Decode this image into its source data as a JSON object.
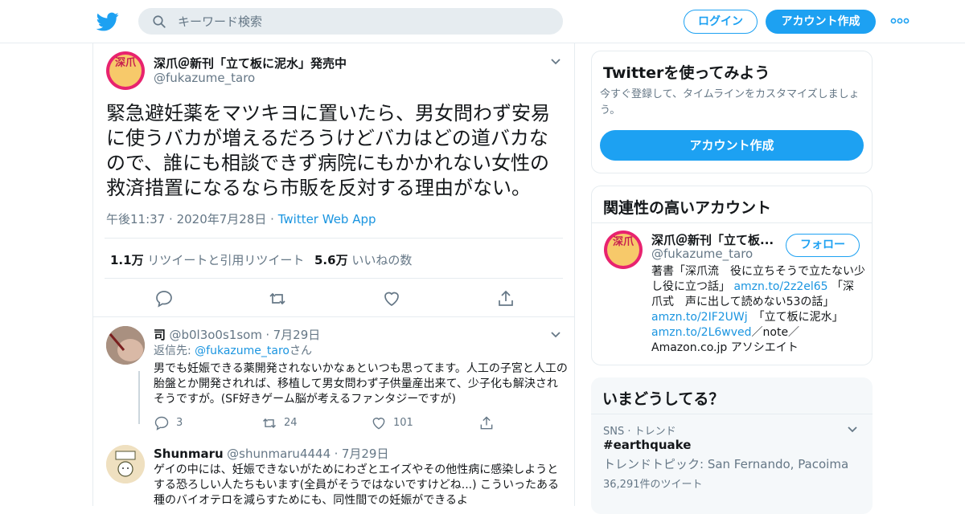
{
  "header": {
    "search_placeholder": "キーワード検索",
    "login_label": "ログイン",
    "signup_label": "アカウント作成"
  },
  "tweet": {
    "author_name": "深爪＠新刊「立て板に泥水」発売中",
    "author_handle": "@fukazume_taro",
    "avatar_text": "深爪",
    "body": "緊急避妊薬をマツキヨに置いたら、男女問わず安易に使うバカが増えるだろうけどバカはどの道バカなので、誰にも相談できず病院にもかかれない女性の救済措置になるなら市販を反対する理由がない。",
    "time": "午後11:37",
    "date": "2020年7月28日",
    "source": "Twitter Web App",
    "retweet_count": "1.1万",
    "retweet_label": "リツイートと引用リツイート",
    "like_count": "5.6万",
    "like_label": "いいねの数"
  },
  "replies": [
    {
      "name": "司",
      "handle": "@b0l3o0s1som",
      "date": "7月29日",
      "reply_to_label": "返信先:",
      "reply_to_handle": "@fukazume_taro",
      "reply_to_suffix": "さん",
      "text": "男でも妊娠できる薬開発されないかなぁといつも思ってます。人工の子宮と人工の胎盤とか開発されれば、移植して男女問わず子供量産出来て、少子化も解決されそうですが。(SF好きゲーム脳が考えるファンタジーですが)",
      "reply_count": "3",
      "retweet_count": "24",
      "like_count": "101"
    },
    {
      "name": "Shunmaru",
      "handle": "@shunmaru4444",
      "date": "7月29日",
      "text": "ゲイの中には、妊娠できないがためにわざとエイズやその他性病に感染しようとする恐ろしい人たちもいます(全員がそうではないですけどね...) こういったある種のバイオテロを減らすためにも、同性間での妊娠ができるよ"
    }
  ],
  "signup_card": {
    "title": "Twitterを使ってみよう",
    "desc": "今すぐ登録して、タイムラインをカスタマイズしましょう。",
    "button": "アカウント作成"
  },
  "related": {
    "title": "関連性の高いアカウント",
    "name": "深爪＠新刊「立て板...",
    "handle": "@fukazume_taro",
    "follow_label": "フォロー",
    "bio_1": "著書「深爪流　役に立ちそうで立たない少し役に立つ話」",
    "link_1": "amzn.to/2z2el65",
    "bio_2": "「深爪式　声に出して読めない53の話」",
    "link_2": "amzn.to/2IF2UWj",
    "bio_3": "　「立て板に泥水」",
    "link_3": "amzn.to/2L6wved",
    "bio_4": "／note／Amazon.co.jp アソシエイト"
  },
  "trends": {
    "title": "いまどうしてる？",
    "category": "SNS · トレンド",
    "tag": "#earthquake",
    "topic": "トレンドトピック: San Fernando, Pacoima",
    "count": "36,291件のツイート"
  },
  "colors": {
    "brand": "#1da1f2",
    "link": "#1b95e0",
    "muted": "#657786"
  }
}
